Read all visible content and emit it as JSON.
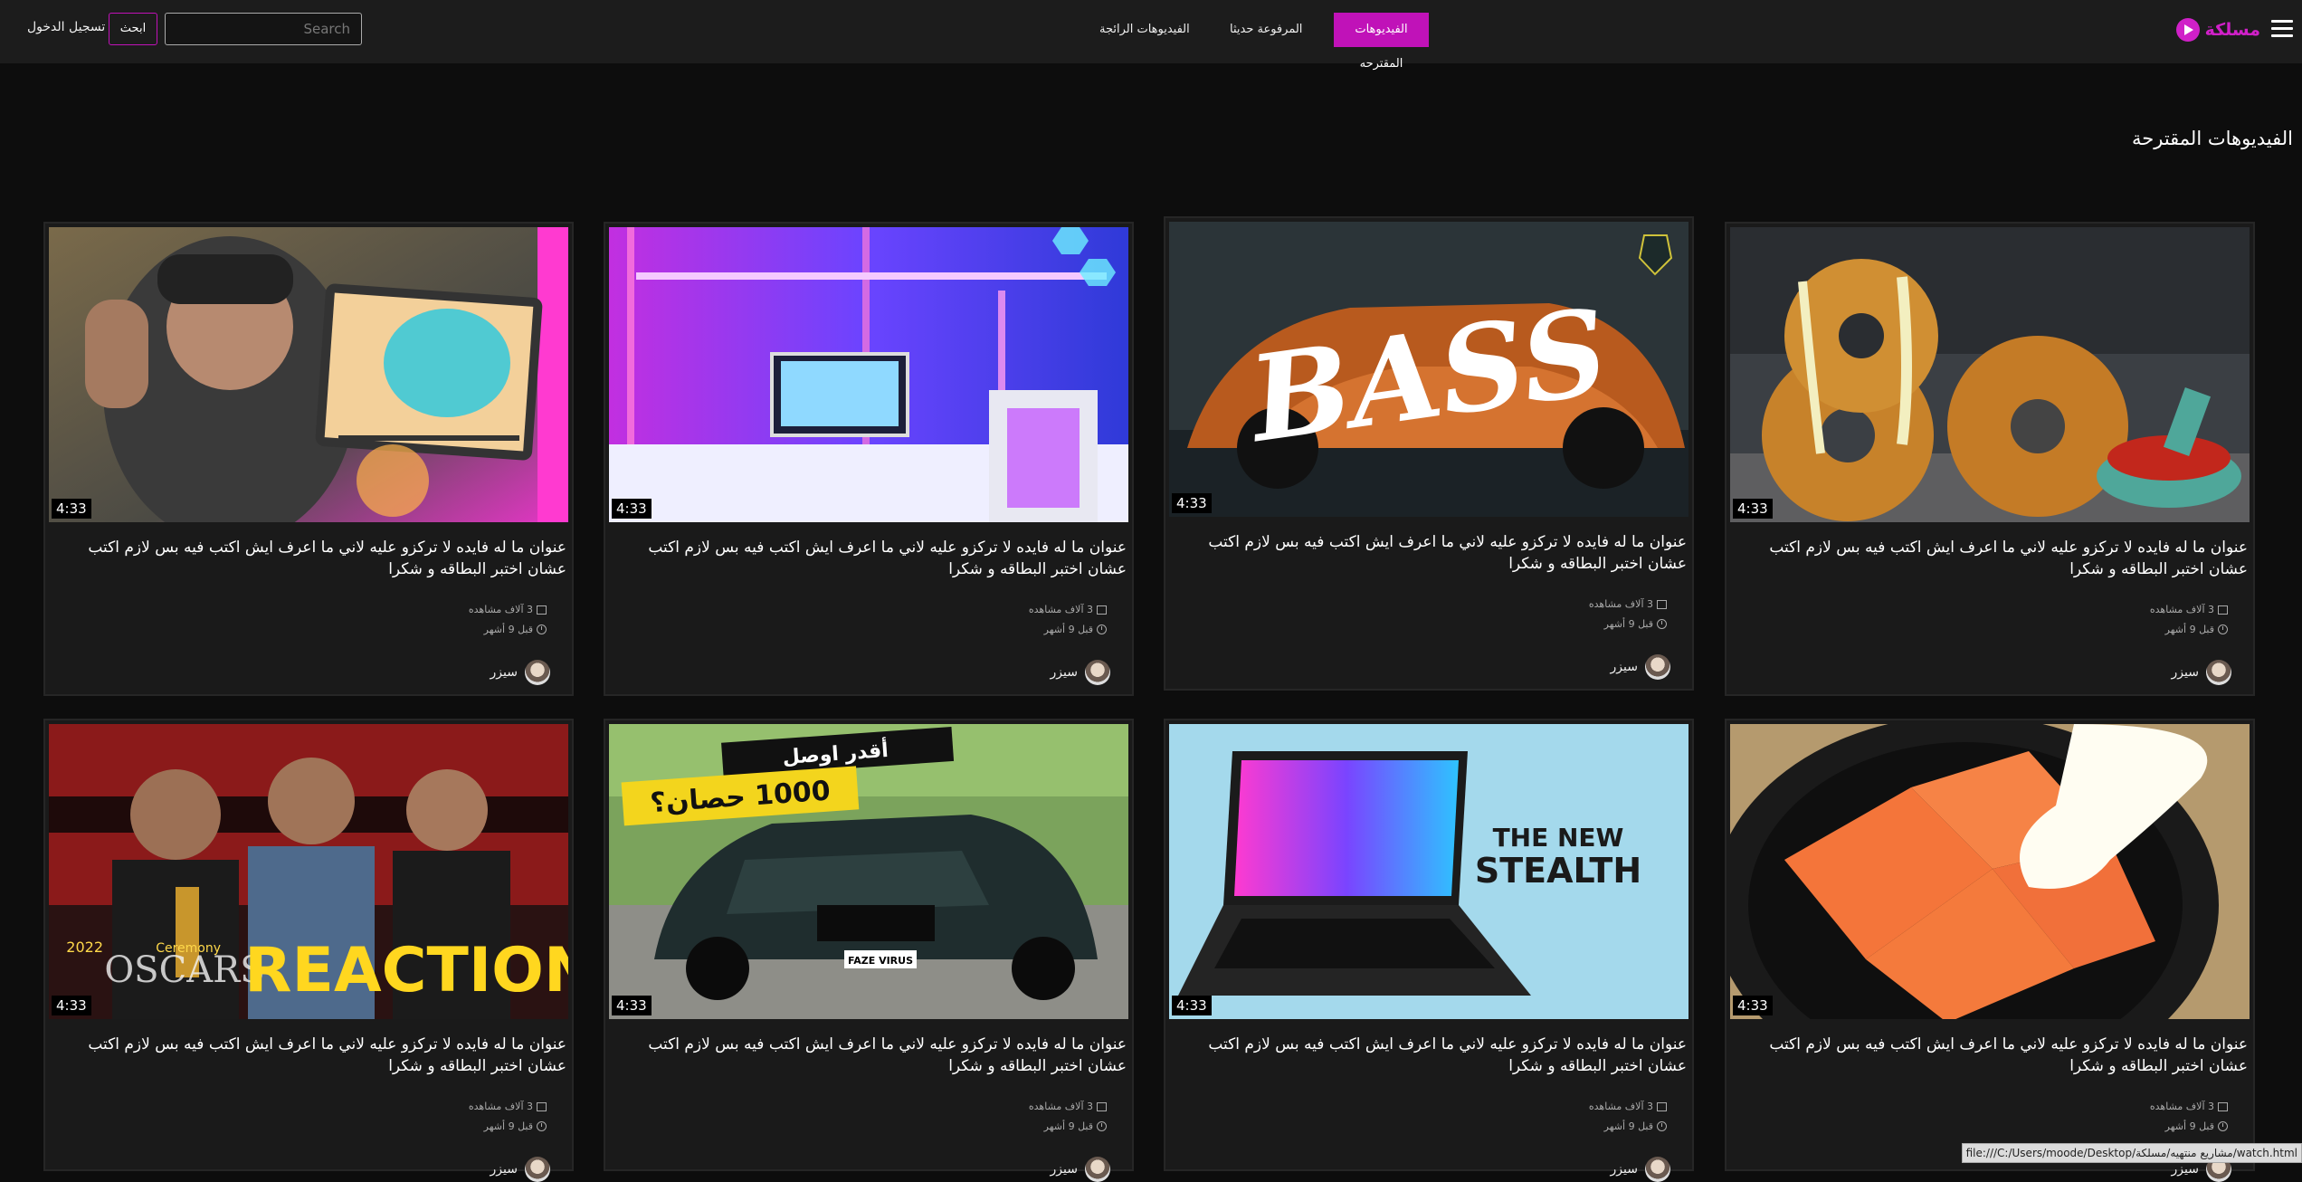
{
  "header": {
    "logo_text": "مسلكة",
    "nav": [
      "الفيديوهات المقترحه",
      "المرفوعة حديثا",
      "الفيديوهات الرائجة"
    ],
    "search_placeholder": "Search",
    "search_button": "ابحث",
    "login": "تسجيل الدخول"
  },
  "section_title": "الفيديوهات المقترحة",
  "video_title": "عنوان ما له فايده لا تركزو عليه لاني ما اعرف ايش اكتب فيه بس لازم اكتب عشان اختبر البطاقه و شكرا",
  "views": "3 آلاف مشاهده",
  "age": "قبل 9 أشهر",
  "channel": "سيزر",
  "duration": "4:33",
  "thumbs": [
    "onion-rings",
    "bass-car",
    "gaming-setup",
    "tablet-review",
    "salmon",
    "laptop-stealth",
    "mercedes",
    "oscars-reaction"
  ],
  "thumb_text": {
    "bass": "BASS",
    "stealth_1": "THE NEW",
    "stealth_2": "STEALTH",
    "merc_1": "أقدر اوصل",
    "merc_2": "1000 حصان؟",
    "oscars_1": "REACTION",
    "oscars_2": "OSCARS",
    "oscars_3": "2022",
    "oscars_4": "Ceremony",
    "merc_plate": "FAZE VIRUS"
  },
  "statusbar": "file:///C:/Users/moode/Desktop/مشاريع منتهيه/مسلكة/watch.html"
}
